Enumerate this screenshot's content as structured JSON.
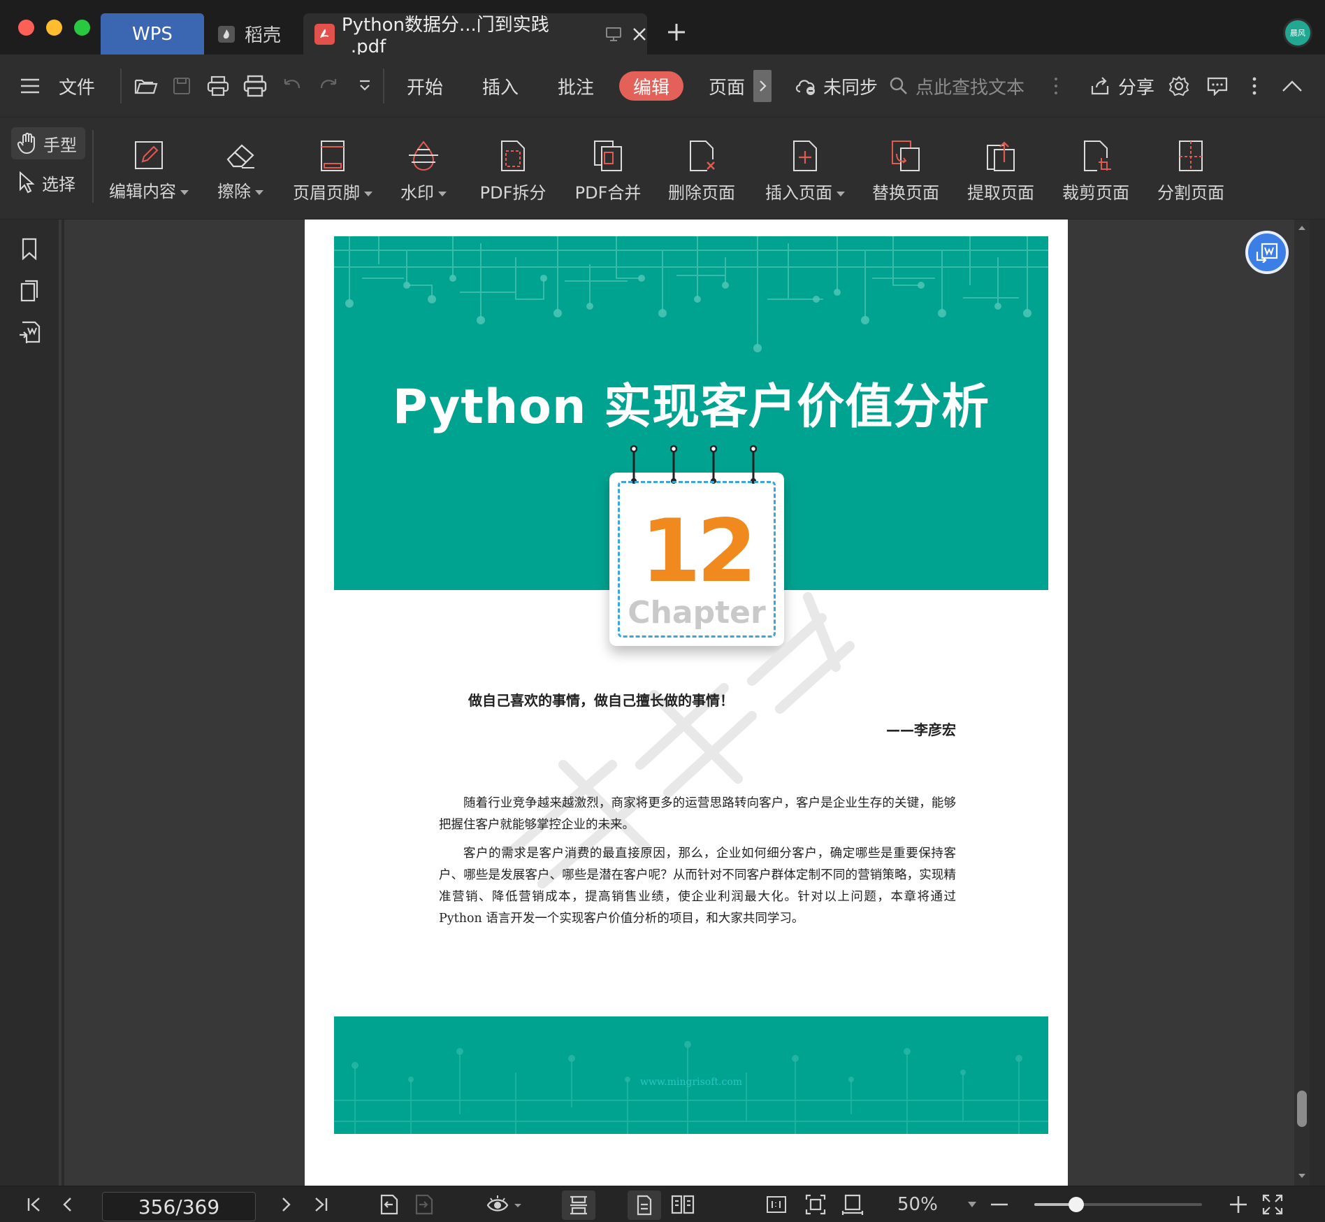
{
  "titlebar": {
    "tabs": [
      {
        "label": "WPS"
      },
      {
        "label": "稻壳"
      },
      {
        "label": "Python数据分...门到实践_.pdf"
      }
    ],
    "avatar_text": "晨风",
    "traffic_colors": [
      "#fe5f57",
      "#febc2e",
      "#28c840"
    ]
  },
  "menubar": {
    "file_label": "文件",
    "tabs": [
      {
        "label": "开始"
      },
      {
        "label": "插入"
      },
      {
        "label": "批注"
      },
      {
        "label": "编辑",
        "active": true
      },
      {
        "label": "页面"
      }
    ],
    "sync_label": "未同步",
    "search_placeholder": "点此查找文本",
    "share_label": "分享"
  },
  "ribbon": {
    "hand_tool": "手型",
    "select_tool": "选择",
    "buttons": [
      {
        "label": "编辑内容",
        "dropdown": true
      },
      {
        "label": "擦除",
        "dropdown": true
      },
      {
        "label": "页眉页脚",
        "dropdown": true
      },
      {
        "label": "水印",
        "dropdown": true
      },
      {
        "label": "PDF拆分"
      },
      {
        "label": "PDF合并"
      },
      {
        "label": "删除页面"
      },
      {
        "label": "插入页面",
        "dropdown": true
      },
      {
        "label": "替换页面"
      },
      {
        "label": "提取页面"
      },
      {
        "label": "裁剪页面"
      },
      {
        "label": "分割页面"
      }
    ]
  },
  "document": {
    "hero_title": "Python 实现客户价值分析",
    "chapter_number": "12",
    "chapter_word": "Chapter",
    "quote": "做自己喜欢的事情，做自己擅长做的事情！",
    "author": "——李彦宏",
    "paragraph1": "随着行业竞争越来越激烈，商家将更多的运营思路转向客户，客户是企业生存的关键，能够把握住客户就能够掌控企业的未来。",
    "paragraph2": "客户的需求是客户消费的最直接原因，那么，企业如何细分客户，确定哪些是重要保持客户、哪些是发展客户、哪些是潜在客户呢？从而针对不同客户群体定制不同的营销策略，实现精准营销、降低营销成本，提高销售业绩，使企业利润最大化。针对以上问题，本章将通过 Python 语言开发一个实现客户价值分析的项目，和大家共同学习。",
    "footer_url": "www.mingrisoft.com",
    "brand_color": "#00a390",
    "chapter_color": "#f08a1e"
  },
  "statusbar": {
    "page_indicator": "356/369",
    "zoom": "50%",
    "zoom_level": 0.25
  }
}
